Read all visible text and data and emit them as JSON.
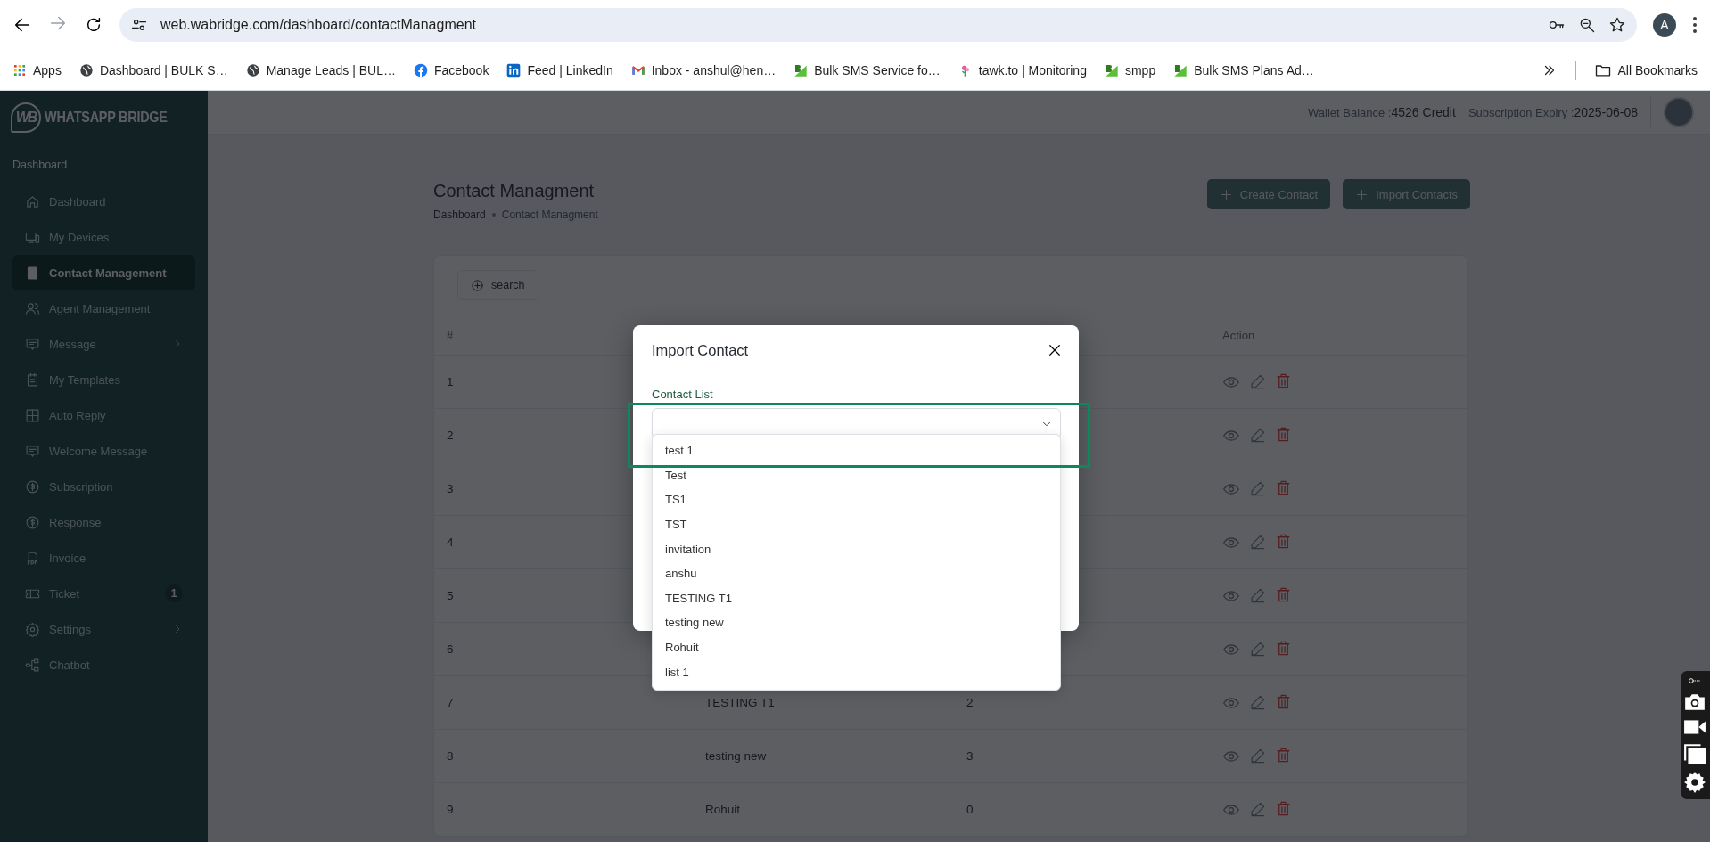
{
  "browser": {
    "url": "web.wabridge.com/dashboard/contactManagment",
    "profile_initial": "A",
    "bookmarks": [
      {
        "label": "Apps",
        "kind": "apps"
      },
      {
        "label": "Dashboard | BULK S…",
        "kind": "globe"
      },
      {
        "label": "Manage Leads | BUL…",
        "kind": "globe"
      },
      {
        "label": "Facebook",
        "kind": "facebook"
      },
      {
        "label": "Feed | LinkedIn",
        "kind": "linkedin"
      },
      {
        "label": "Inbox - anshul@hen…",
        "kind": "gmail"
      },
      {
        "label": "Bulk SMS Service fo…",
        "kind": "bs"
      },
      {
        "label": "tawk.to | Monitoring",
        "kind": "tawk"
      },
      {
        "label": "smpp",
        "kind": "bs"
      },
      {
        "label": "Bulk SMS Plans Ad…",
        "kind": "bs"
      }
    ],
    "all_bookmarks": "All Bookmarks"
  },
  "sidebar": {
    "logo_mark": "WB",
    "logo": "WHATSAPP BRIDGE",
    "section": "Dashboard",
    "items": [
      {
        "label": "Dashboard",
        "selected": false,
        "submenu": false
      },
      {
        "label": "My Devices",
        "selected": false,
        "submenu": false
      },
      {
        "label": "Contact Management",
        "selected": true,
        "submenu": false
      },
      {
        "label": "Agent Management",
        "selected": false,
        "submenu": false
      },
      {
        "label": "Message",
        "selected": false,
        "submenu": true
      },
      {
        "label": "My Templates",
        "selected": false,
        "submenu": false
      },
      {
        "label": "Auto Reply",
        "selected": false,
        "submenu": false
      },
      {
        "label": "Welcome Message",
        "selected": false,
        "submenu": false
      },
      {
        "label": "Subscription",
        "selected": false,
        "submenu": false
      },
      {
        "label": "Response",
        "selected": false,
        "submenu": false
      },
      {
        "label": "Invoice",
        "selected": false,
        "submenu": false
      },
      {
        "label": "Ticket",
        "selected": false,
        "submenu": false,
        "badge": "1"
      },
      {
        "label": "Settings",
        "selected": false,
        "submenu": true
      },
      {
        "label": "Chatbot",
        "selected": false,
        "submenu": false
      }
    ]
  },
  "header": {
    "wallet_label": "Wallet Balance :",
    "wallet_value": "4526 Credit",
    "expiry_label": "Subscription Expiry :",
    "expiry_value": "2025-06-08"
  },
  "page": {
    "title": "Contact Managment",
    "breadcrumb": [
      "Dashboard",
      "Contact Managment"
    ],
    "buttons": [
      "Create Contact",
      "Import Contacts"
    ],
    "search_button": "search"
  },
  "table": {
    "columns": [
      "#",
      "Action"
    ],
    "rows": [
      {
        "number": "1"
      },
      {
        "number": "2"
      },
      {
        "number": "3"
      },
      {
        "number": "4"
      },
      {
        "number": "5"
      },
      {
        "number": "6"
      },
      {
        "number": "7",
        "column_2": "TESTING T1",
        "column_3": "2"
      },
      {
        "number": "8",
        "column_2": "testing new",
        "column_3": "3"
      },
      {
        "number": "9",
        "column_2": "Rohuit",
        "column_3": "0"
      }
    ]
  },
  "modal": {
    "title": "Import Contact",
    "field_label": "Contact List",
    "options": [
      "test 1",
      "Test",
      "TS1",
      "TST",
      "invitation",
      "anshu",
      "TESTING T1",
      "testing new",
      "Rohuit",
      "list 1"
    ]
  }
}
